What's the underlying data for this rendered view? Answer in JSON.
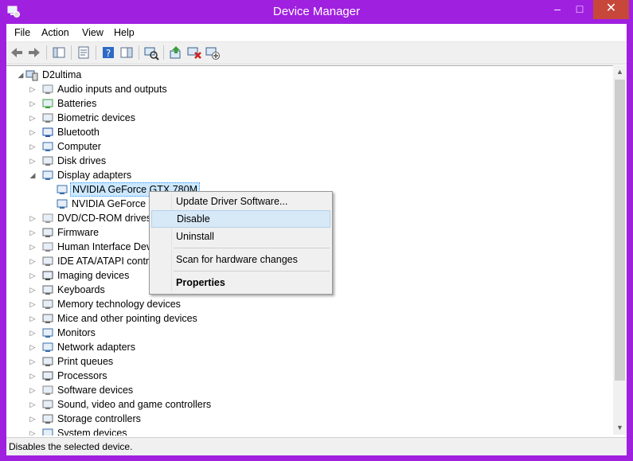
{
  "window": {
    "title": "Device Manager",
    "minimize": "–",
    "maximize": "□",
    "close": "✕"
  },
  "menu": [
    "File",
    "Action",
    "View",
    "Help"
  ],
  "tree": {
    "root": "D2ultima",
    "items": [
      {
        "label": "Audio inputs and outputs",
        "icon": "speaker-icon"
      },
      {
        "label": "Batteries",
        "icon": "battery-icon"
      },
      {
        "label": "Biometric devices",
        "icon": "fingerprint-icon"
      },
      {
        "label": "Bluetooth",
        "icon": "bluetooth-icon"
      },
      {
        "label": "Computer",
        "icon": "computer-icon"
      },
      {
        "label": "Disk drives",
        "icon": "disk-drive-icon"
      },
      {
        "label": "Display adapters",
        "icon": "display-adapter-icon",
        "expanded": true
      },
      {
        "label": "NVIDIA GeForce GTX 780M",
        "icon": "gpu-icon",
        "child": true,
        "selected": true
      },
      {
        "label": "NVIDIA GeForce GTX 780M",
        "icon": "gpu-icon",
        "child": true
      },
      {
        "label": "DVD/CD-ROM drives",
        "icon": "dvd-icon"
      },
      {
        "label": "Firmware",
        "icon": "firmware-icon"
      },
      {
        "label": "Human Interface Devices",
        "icon": "hid-icon"
      },
      {
        "label": "IDE ATA/ATAPI controllers",
        "icon": "ide-icon"
      },
      {
        "label": "Imaging devices",
        "icon": "camera-icon"
      },
      {
        "label": "Keyboards",
        "icon": "keyboard-icon"
      },
      {
        "label": "Memory technology devices",
        "icon": "memory-icon"
      },
      {
        "label": "Mice and other pointing devices",
        "icon": "mouse-icon"
      },
      {
        "label": "Monitors",
        "icon": "monitor-icon"
      },
      {
        "label": "Network adapters",
        "icon": "network-icon"
      },
      {
        "label": "Print queues",
        "icon": "printer-icon"
      },
      {
        "label": "Processors",
        "icon": "processor-icon"
      },
      {
        "label": "Software devices",
        "icon": "software-device-icon"
      },
      {
        "label": "Sound, video and game controllers",
        "icon": "sound-icon"
      },
      {
        "label": "Storage controllers",
        "icon": "storage-icon"
      },
      {
        "label": "System devices",
        "icon": "system-icon"
      }
    ]
  },
  "context_menu": {
    "update": "Update Driver Software...",
    "disable": "Disable",
    "uninstall": "Uninstall",
    "scan": "Scan for hardware changes",
    "properties": "Properties"
  },
  "status": "Disables the selected device.",
  "colors": {
    "frame": "#a020e0",
    "close": "#c7473b",
    "highlight": "#d7e8f6"
  }
}
